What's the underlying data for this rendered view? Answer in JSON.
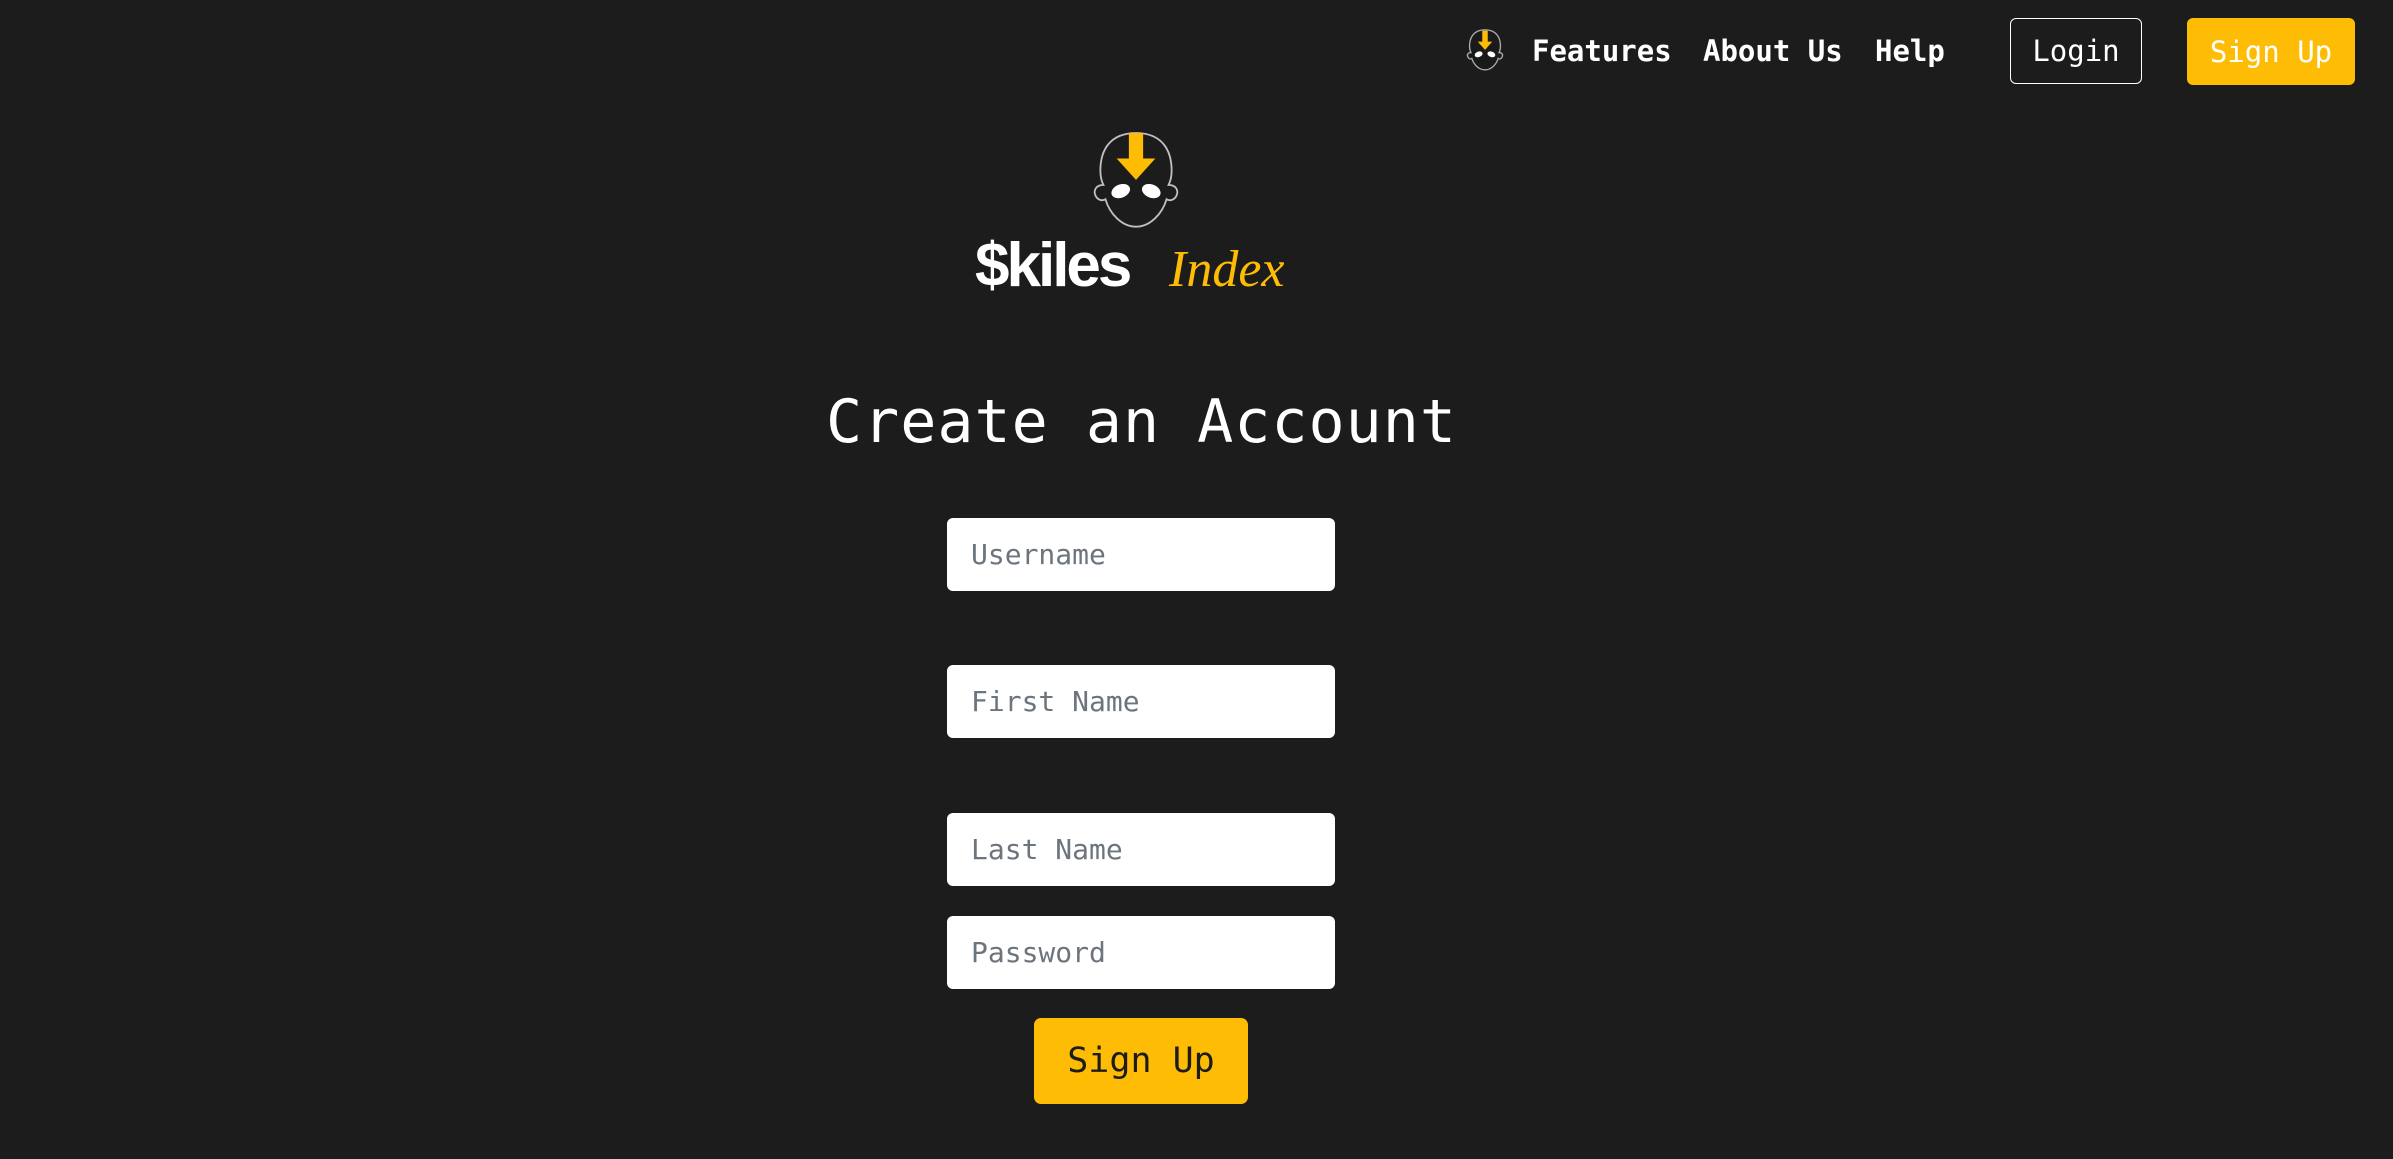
{
  "brand": {
    "wordmark_primary": "$kiles",
    "wordmark_accent": "Index",
    "accent_color": "#ffbc05",
    "background_color": "#1c1c1c",
    "mascot_icon": "mascot-head-arrow-icon"
  },
  "nav": {
    "logo_icon": "mascot-head-arrow-icon",
    "features_label": "Features",
    "about_label": "About Us",
    "help_label": "Help",
    "login_label": "Login",
    "signup_label": "Sign Up"
  },
  "form": {
    "title": "Create an Account",
    "username_placeholder": "Username",
    "first_name_placeholder": "First Name",
    "last_name_placeholder": "Last Name",
    "password_placeholder": "Password",
    "submit_label": "Sign Up"
  }
}
